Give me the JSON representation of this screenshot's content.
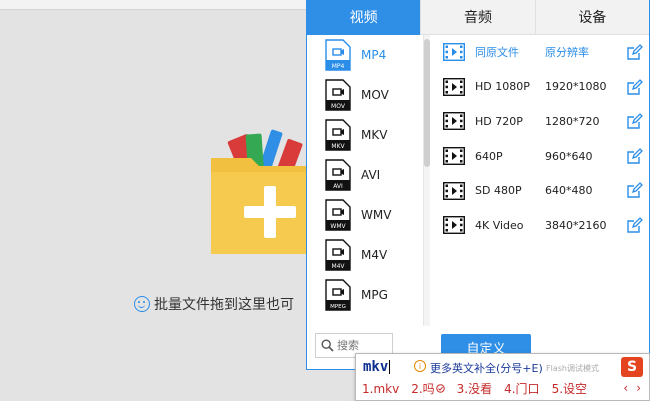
{
  "drop_area": {
    "hint_text": "批量文件拖到这里也可"
  },
  "tabs": [
    {
      "label": "视频",
      "active": true
    },
    {
      "label": "音频",
      "active": false
    },
    {
      "label": "设备",
      "active": false
    }
  ],
  "formats": [
    {
      "label": "MP4",
      "tag": "MP4",
      "selected": true
    },
    {
      "label": "MOV",
      "tag": "MOV",
      "selected": false
    },
    {
      "label": "MKV",
      "tag": "MKV",
      "selected": false
    },
    {
      "label": "AVI",
      "tag": "AVI",
      "selected": false
    },
    {
      "label": "WMV",
      "tag": "WMV",
      "selected": false
    },
    {
      "label": "M4V",
      "tag": "M4V",
      "selected": false
    },
    {
      "label": "MPG",
      "tag": "MPEG",
      "selected": false
    }
  ],
  "resolutions": [
    {
      "name": "同原文件",
      "value": "原分辨率"
    },
    {
      "name": "HD 1080P",
      "value": "1920*1080"
    },
    {
      "name": "HD 720P",
      "value": "1280*720"
    },
    {
      "name": "640P",
      "value": "960*640"
    },
    {
      "name": "SD 480P",
      "value": "640*480"
    },
    {
      "name": "4K Video",
      "value": "3840*2160"
    }
  ],
  "search": {
    "placeholder": "搜索"
  },
  "custom_button": {
    "label": "自定义"
  },
  "ime": {
    "input": "mkv",
    "more_hint": "更多英文补全(分号+E)",
    "flash_hint": "Flash调试模式",
    "logo": "S",
    "candidates": [
      "1.mkv",
      "2.吗",
      "3.没看",
      "4.门口",
      "5.设空"
    ],
    "prev": "‹",
    "next": "›"
  },
  "colors": {
    "accent": "#2f8fe6",
    "folder": "#f2c041",
    "ime_red": "#c62a2a"
  }
}
